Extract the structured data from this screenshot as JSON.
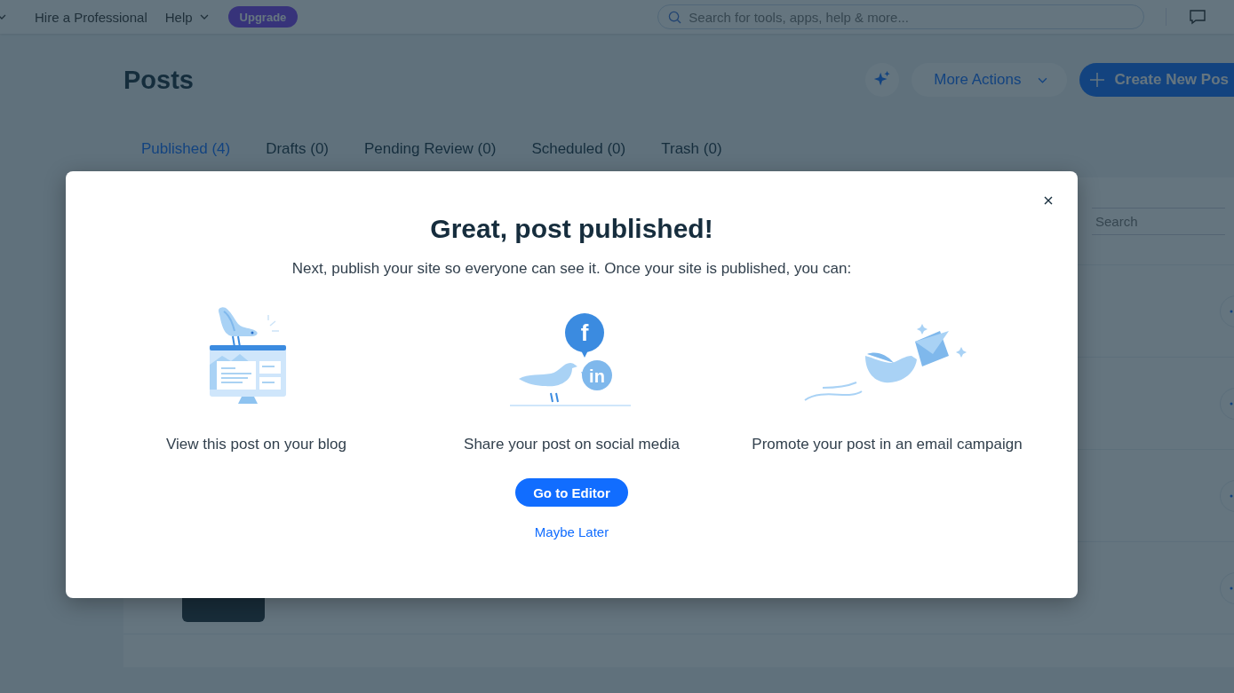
{
  "top_bar": {
    "nav_items": [
      {
        "label": "Hire a Professional",
        "dropdown": false
      },
      {
        "label": "Help",
        "dropdown": true
      }
    ],
    "upgrade_button": "Upgrade",
    "search": {
      "placeholder": "Search for tools, apps, help & more..."
    }
  },
  "page": {
    "title": "Posts",
    "more_actions": "More Actions",
    "create_button": "Create New Pos"
  },
  "tabs": [
    {
      "label": "Published (4)",
      "selected": true
    },
    {
      "label": "Drafts (0)",
      "selected": false
    },
    {
      "label": "Pending Review (0)",
      "selected": false
    },
    {
      "label": "Scheduled (0)",
      "selected": false
    },
    {
      "label": "Trash (0)",
      "selected": false
    }
  ],
  "table": {
    "search": {
      "placeholder": "Search"
    },
    "rows": [
      {
        "kind": "post"
      },
      {
        "kind": "post"
      },
      {
        "kind": "post"
      },
      {
        "kind": "post"
      }
    ]
  },
  "modal": {
    "title": "Great, post published!",
    "message": "Next, publish your site so everyone can see it. Once your site is published, you can:",
    "options": [
      {
        "kind": "blog",
        "caption": "View this post on your blog"
      },
      {
        "kind": "social",
        "caption": "Share your post on social media",
        "badges": [
          "f",
          "in"
        ]
      },
      {
        "kind": "email",
        "caption": "Promote your post in an email campaign"
      }
    ],
    "primary_button": "Go to Editor",
    "secondary_link": "Maybe Later"
  }
}
